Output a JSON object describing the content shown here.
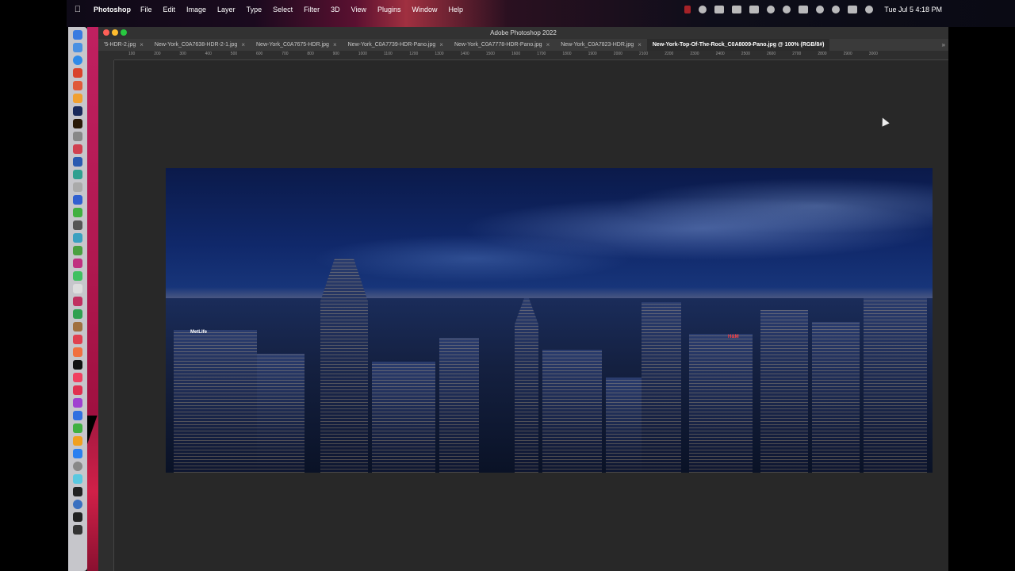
{
  "menubar": {
    "apple_icon": "apple-logo-icon",
    "app_name": "Photoshop",
    "items": [
      "File",
      "Edit",
      "Image",
      "Layer",
      "Type",
      "Select",
      "Filter",
      "3D",
      "View",
      "Plugins",
      "Window",
      "Help"
    ],
    "clock": "Tue Jul 5  4:18 PM"
  },
  "window": {
    "title": "Adobe Photoshop 2022"
  },
  "tabs": [
    {
      "label": "'5-HDR-2.jpg",
      "active": false
    },
    {
      "label": "New-York_C0A7638-HDR-2-1.jpg",
      "active": false
    },
    {
      "label": "New-York_C0A7675-HDR.jpg",
      "active": false
    },
    {
      "label": "New-York_C0A7739-HDR-Pano.jpg",
      "active": false
    },
    {
      "label": "New-York_C0A7778-HDR-Pano.jpg",
      "active": false
    },
    {
      "label": "New-York_C0A7823-HDR.jpg",
      "active": false
    },
    {
      "label": "New-York-Top-Of-The-Rock_C0A8009-Pano.jpg @ 100% (RGB/8#)",
      "active": true
    }
  ],
  "tab_overflow": "»",
  "ruler": {
    "top_labels": [
      "100",
      "200",
      "300",
      "400",
      "500",
      "600",
      "700",
      "800",
      "900",
      "1000",
      "1100",
      "1200",
      "1300",
      "1400",
      "1500",
      "1600",
      "1700",
      "1800",
      "1900",
      "2000",
      "2100",
      "2200",
      "2300",
      "2400",
      "2500",
      "2600",
      "2700",
      "2800",
      "2900",
      "3000"
    ]
  },
  "photo": {
    "left_sign": "MetLife",
    "right_sign": "H&M"
  },
  "colors": {
    "ps_bg": "#282828",
    "sky_top": "#0b1a4a",
    "accent_red": "#c0262a"
  }
}
